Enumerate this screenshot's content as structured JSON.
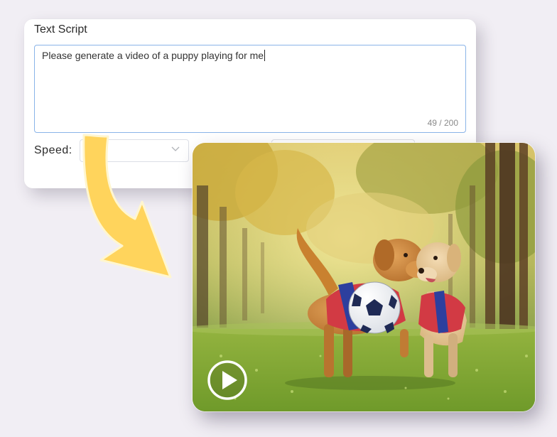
{
  "form": {
    "field_title": "Text Script",
    "prompt_text": "Please generate a video of a puppy playing for me",
    "char_counter": "49 / 200",
    "speed_label": "Speed:"
  },
  "video": {
    "subject": "two-dogs-playing-soccer",
    "play_icon": "play-icon"
  },
  "colors": {
    "textarea_border": "#8ab4e8",
    "arrow_fill": "#ffd45c",
    "arrow_outline": "#fff6cf",
    "jersey_red": "#d23a44",
    "jersey_blue": "#2d3f9e"
  }
}
